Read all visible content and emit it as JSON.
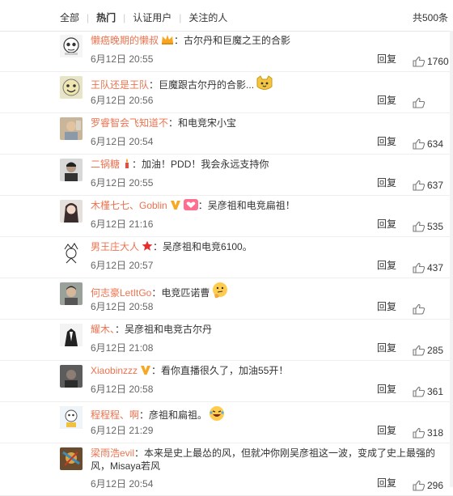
{
  "filter": {
    "tabs": [
      "全部",
      "热门",
      "认证用户",
      "关注的人"
    ],
    "active": "热门",
    "total": "共500条"
  },
  "reply_label": "回复",
  "comments": [
    {
      "name": "懒癌晚期的懒叔",
      "badge": "crown-badge-icon",
      "text": "古尔丹和巨魔之王的合影",
      "time": "6月12日 20:55",
      "likes": "1760",
      "avatar": "panda-avatar"
    },
    {
      "name": "王队还是王队",
      "badge": "",
      "text": "巨魔跟古尔丹的合影...",
      "emoji": "cat-face-emoji",
      "time": "6月12日 20:56",
      "likes": "",
      "avatar": "meme-face-avatar"
    },
    {
      "name": "罗睿智会飞知道不",
      "badge": "",
      "text": "和电竞宋小宝",
      "time": "6月12日 20:54",
      "likes": "634",
      "avatar": "man-photo-avatar"
    },
    {
      "name": "二锅糖",
      "badge": "candle-badge-icon",
      "text": "加油！PDD！我会永远支持你",
      "time": "6月12日 20:55",
      "likes": "637",
      "avatar": "portrait-avatar"
    },
    {
      "name": "木槿七七、Goblin",
      "badge": "vip-v-icon",
      "badge2": "heart-badge-icon",
      "text": "吴彦祖和电竞扁祖！",
      "time": "6月12日 21:16",
      "likes": "535",
      "avatar": "girl-photo-avatar"
    },
    {
      "name": "男王庄大人",
      "badge": "star-badge-icon",
      "text": "吴彦祖和电竞6100。",
      "time": "6月12日 20:57",
      "likes": "437",
      "avatar": "sketch-avatar"
    },
    {
      "name": "何志豪LetItGo",
      "badge": "",
      "text": "电竞匹诺曹",
      "emoji": "thinking-face-emoji",
      "time": "6月12日 20:58",
      "likes": "",
      "avatar": "boy-photo-avatar"
    },
    {
      "name": "耀木、",
      "badge": "",
      "text": "吴彦祖和电竞古尔丹",
      "time": "6月12日 21:08",
      "likes": "285",
      "avatar": "suit-avatar"
    },
    {
      "name": "Xiaobinzzz",
      "badge": "vip-v-icon",
      "text": "看你直播很久了，加油55开！",
      "time": "6月12日 20:58",
      "likes": "361",
      "avatar": "dark-photo-avatar"
    },
    {
      "name": "程程程、啊",
      "badge": "",
      "text": "彦祖和扁祖。",
      "emoji": "laughing-face-emoji",
      "time": "6月12日 21:29",
      "likes": "318",
      "avatar": "cartoon-avatar"
    },
    {
      "name": "梁雨浩evil",
      "badge": "",
      "text": "本来是史上最怂的风，但就冲你刚吴彦祖这一波，变成了史上最强的风，Misaya若风",
      "time": "6月12日 20:54",
      "likes": "296",
      "avatar": "colorful-avatar"
    }
  ]
}
